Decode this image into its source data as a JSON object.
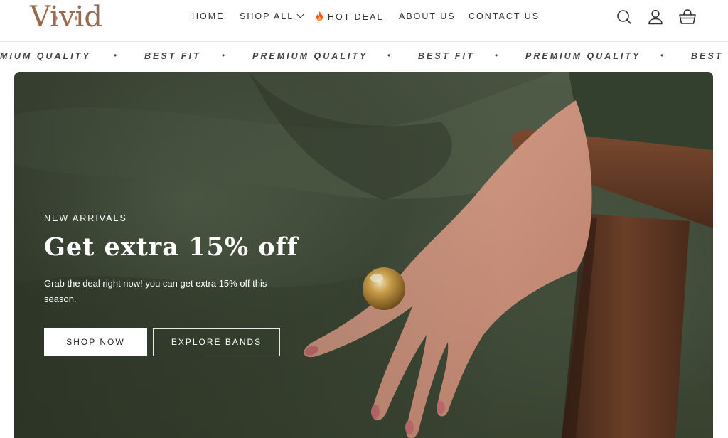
{
  "brand": {
    "logo_text": "Vivid"
  },
  "nav": {
    "items": [
      {
        "label": "HOME"
      },
      {
        "label": "SHOP ALL"
      },
      {
        "label": "HOT DEAL"
      },
      {
        "label": "ABOUT US"
      },
      {
        "label": "CONTACT US"
      }
    ]
  },
  "header_icons": [
    "search-icon",
    "account-icon",
    "cart-icon"
  ],
  "marquee": {
    "items": [
      "MIUM QUALITY",
      "BEST FIT",
      "PREMIUM QUALITY",
      "BEST FIT",
      "PREMIUM QUALITY",
      "BEST F"
    ],
    "separator": "•"
  },
  "hero": {
    "eyebrow": "NEW ARRIVALS",
    "title": "Get extra 15% off",
    "subtitle": "Grab the deal right now! you can get extra 15% off this season.",
    "primary_button": "SHOP NOW",
    "secondary_button": "EXPLORE BANDS"
  },
  "colors": {
    "brand": "#9a6a4c",
    "hero_bg": "#48523f",
    "text_dark": "#333333",
    "flame": "#e0531c"
  }
}
